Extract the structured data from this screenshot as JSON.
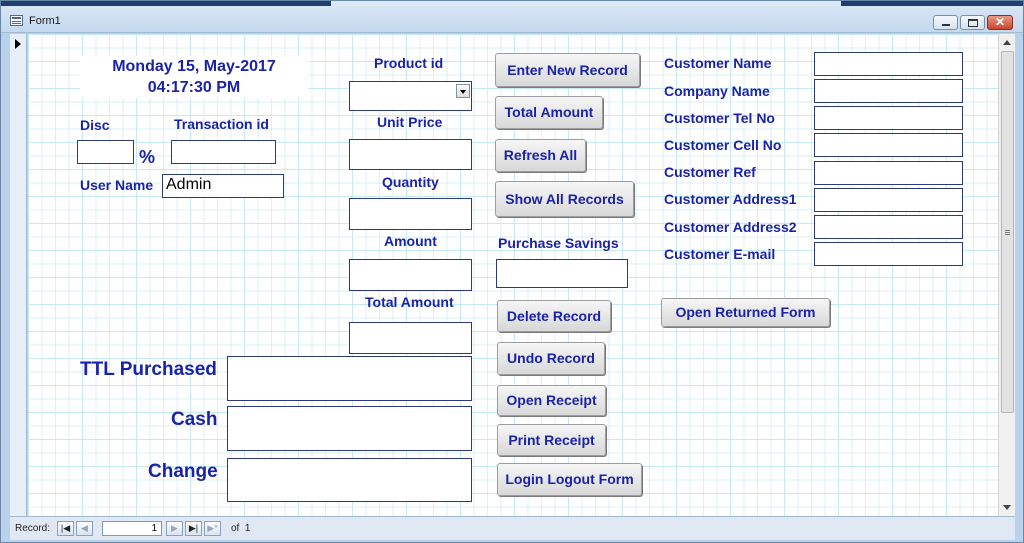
{
  "window": {
    "title": "Form1",
    "close_glyph": "✕"
  },
  "header": {
    "date": "Monday 15, May-2017",
    "time": "04:17:30 PM"
  },
  "left": {
    "disc_label": "Disc",
    "percent": "%",
    "transaction_label": "Transaction id",
    "username_label": "User Name",
    "username_value": "Admin"
  },
  "middle": {
    "product_label": "Product id",
    "unit_price_label": "Unit Price",
    "quantity_label": "Quantity",
    "amount_label": "Amount",
    "total_amount_label": "Total Amount"
  },
  "totals": {
    "ttl_purchased_label": "TTL Purchased",
    "cash_label": "Cash",
    "change_label": "Change"
  },
  "buttons": {
    "enter_new_record": "Enter New Record",
    "total_amount": "Total Amount",
    "refresh_all": "Refresh All",
    "show_all_records": "Show All Records",
    "purchase_savings_label": "Purchase Savings",
    "delete_record": "Delete Record",
    "undo_record": "Undo Record",
    "open_receipt": "Open Receipt",
    "print_receipt": "Print Receipt",
    "login_logout_form": "Login Logout Form",
    "open_returned_form": "Open Returned Form"
  },
  "customer": {
    "fields": [
      "Customer Name",
      "Company Name",
      "Customer Tel No",
      "Customer Cell No",
      "Customer Ref",
      "Customer Address1",
      "Customer Address2",
      "Customer E-mail"
    ]
  },
  "navigation": {
    "record_label": "Record:",
    "first_glyph": "|◀",
    "prev_glyph": "◀",
    "current": "1",
    "next_glyph": "▶",
    "last_glyph": "▶|",
    "new_glyph": "▶*",
    "of_label": "of",
    "total": "1"
  },
  "colors": {
    "label_blue": "#1a23a8",
    "grid_line": "#c7e9f3",
    "field_border": "#2c3a7a"
  }
}
